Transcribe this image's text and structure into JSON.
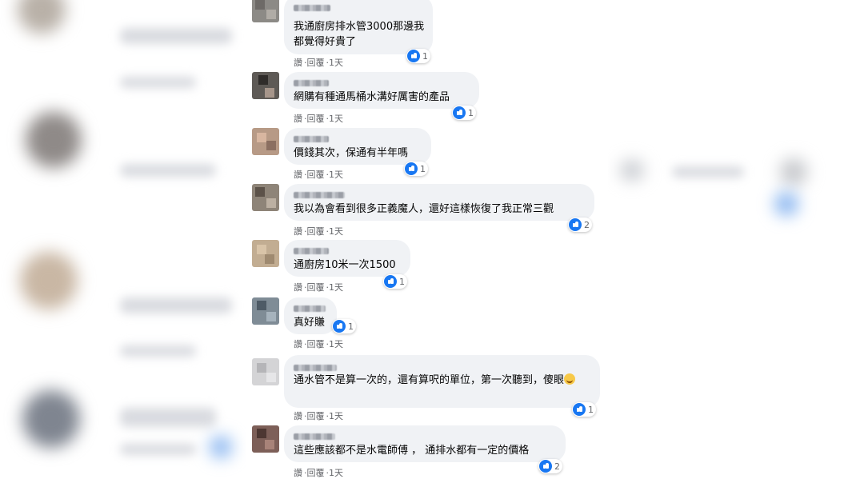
{
  "colors": {
    "like_blue": "#1877f2",
    "bubble_bg": "#f0f2f5",
    "meta_text": "#65676b"
  },
  "comments": [
    {
      "text": "我通廚房排水管3000那邊我都覺得好貴了",
      "reactions": "1",
      "actions": {
        "like": "讚",
        "reply": "回覆",
        "time": "1天"
      }
    },
    {
      "text": "網購有種通馬桶水溝好厲害的產品",
      "reactions": "1",
      "actions": {
        "like": "讚",
        "reply": "回覆",
        "time": "1天"
      }
    },
    {
      "text": "價錢其次，保通有半年嗎",
      "reactions": "1",
      "actions": {
        "like": "讚",
        "reply": "回覆",
        "time": "1天"
      }
    },
    {
      "text": "我以為會看到很多正義魔人，還好這樣恢復了我正常三觀",
      "reactions": "2",
      "actions": {
        "like": "讚",
        "reply": "回覆",
        "time": "1天"
      }
    },
    {
      "text": "通廚房10米一次1500",
      "reactions": "1",
      "actions": {
        "like": "讚",
        "reply": "回覆",
        "time": "1天"
      }
    },
    {
      "text": "真好賺",
      "reactions": "1",
      "actions": {
        "like": "讚",
        "reply": "回覆",
        "time": "1天"
      }
    },
    {
      "text": "通水管不是算一次的，還有算呎的單位，第一次聽到，傻眼",
      "reactions": "1",
      "actions": {
        "like": "讚",
        "reply": "回覆",
        "time": "1天"
      }
    },
    {
      "text": "這些應該都不是水電師傅 ， 通排水都有一定的價格",
      "reactions": "2",
      "actions": {
        "like": "讚",
        "reply": "回覆",
        "time": "1天"
      }
    }
  ]
}
